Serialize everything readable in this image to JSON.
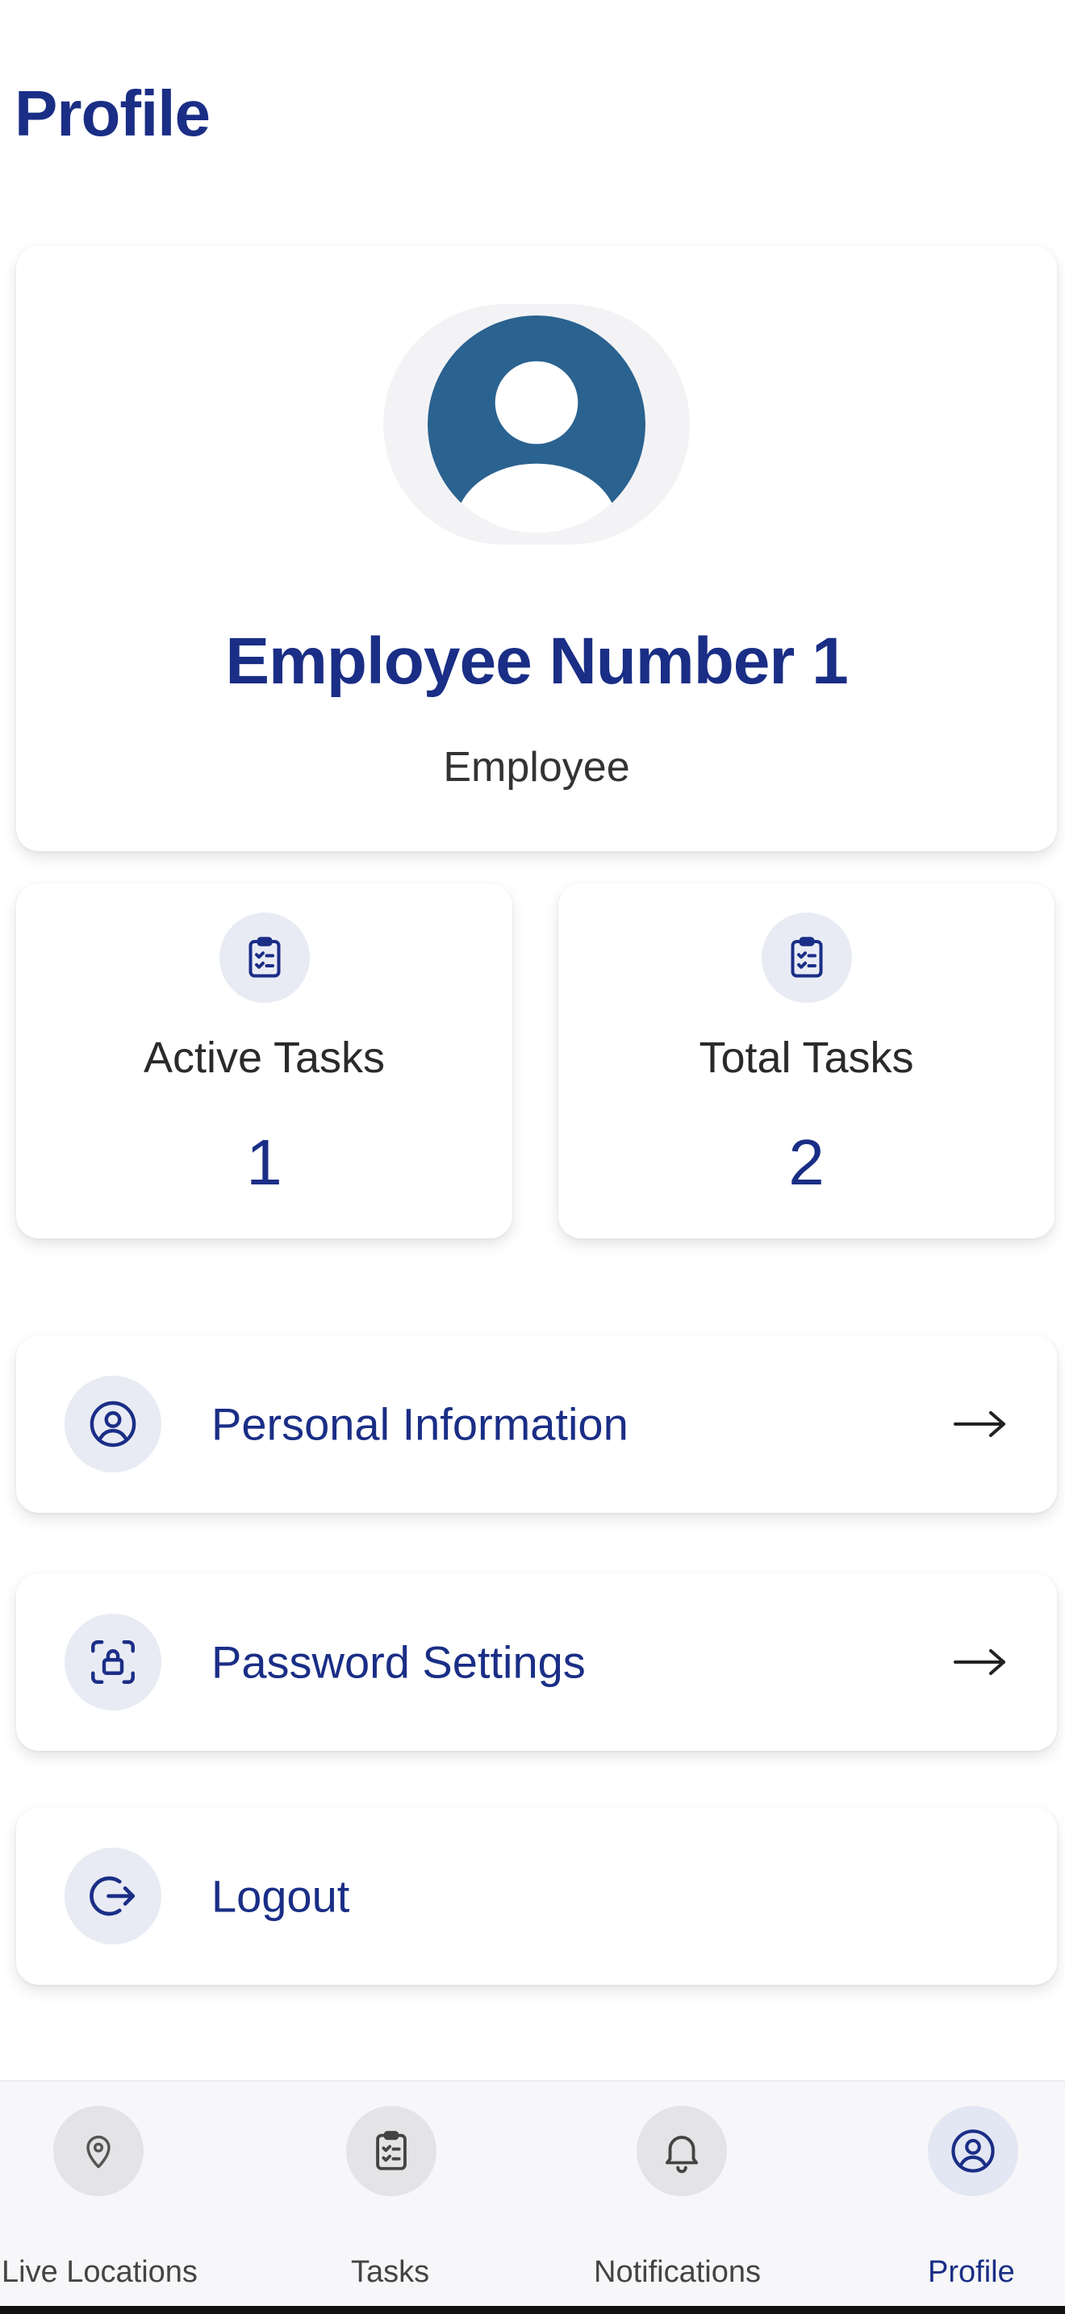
{
  "header": {
    "title": "Profile"
  },
  "profile": {
    "name": "Employee Number 1",
    "role": "Employee"
  },
  "stats": [
    {
      "label": "Active Tasks",
      "value": "1",
      "icon": "clipboard-list-icon"
    },
    {
      "label": "Total Tasks",
      "value": "2",
      "icon": "clipboard-list-icon"
    }
  ],
  "menu": [
    {
      "label": "Personal Information",
      "icon": "user-circle-icon",
      "has_arrow": true
    },
    {
      "label": "Password Settings",
      "icon": "lock-icon",
      "has_arrow": true
    },
    {
      "label": "Logout",
      "icon": "logout-icon",
      "has_arrow": false
    }
  ],
  "bottom_nav": {
    "items": [
      {
        "label": "Live Locations",
        "icon": "map-pin-icon",
        "active": false
      },
      {
        "label": "Tasks",
        "icon": "clipboard-list-icon",
        "active": false
      },
      {
        "label": "Notifications",
        "icon": "bell-icon",
        "active": false
      },
      {
        "label": "Profile",
        "icon": "user-circle-icon",
        "active": true
      }
    ]
  },
  "colors": {
    "accent": "#1a2e86",
    "avatar": "#2a6290",
    "icon_bg": "#e9ebf4",
    "background": "#ffffff"
  }
}
